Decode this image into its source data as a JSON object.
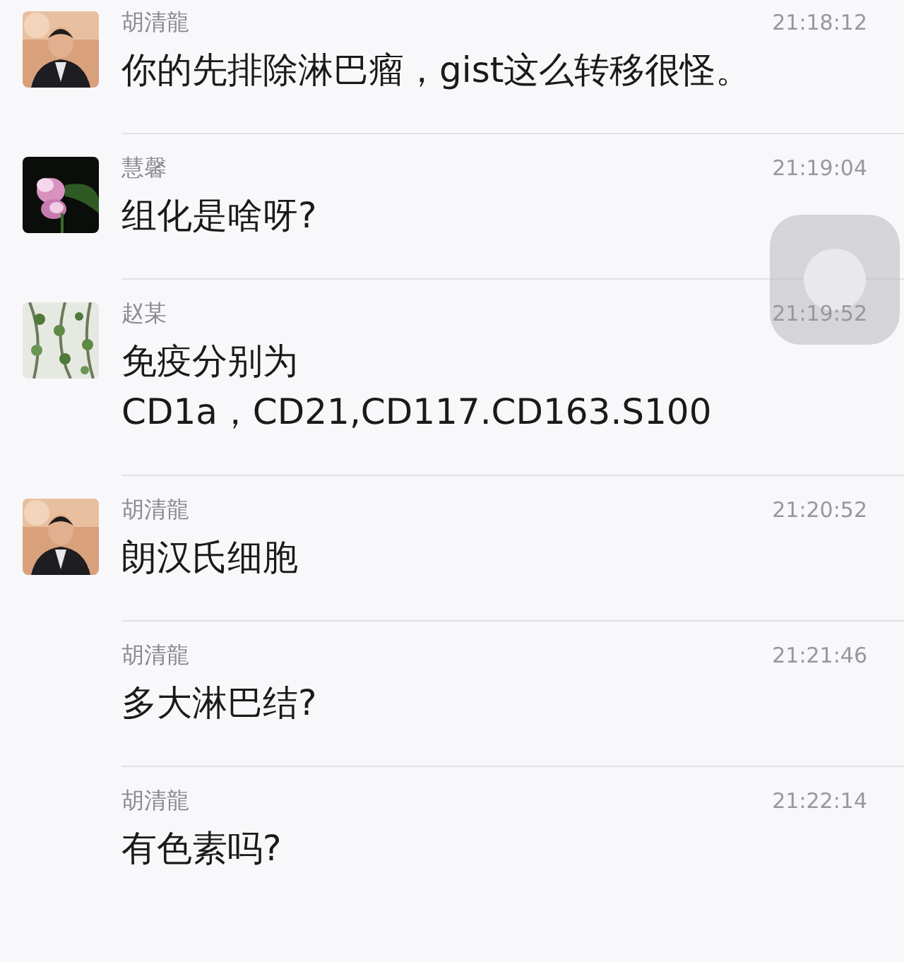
{
  "messages": [
    {
      "sender": "胡清龍",
      "time": "21:18:12",
      "text": "你的先排除淋巴瘤，gist这么转移很怪。"
    },
    {
      "sender": "慧馨",
      "time": "21:19:04",
      "text": "组化是啥呀?"
    },
    {
      "sender": "赵某",
      "time": "21:19:52",
      "text": "免疫分别为\nCD1a，CD21,CD117.CD163.S100"
    },
    {
      "sender": "胡清龍",
      "time": "21:20:52",
      "text": "朗汉氏细胞"
    },
    {
      "sender": "胡清龍",
      "time": "21:21:46",
      "text": "多大淋巴结?"
    },
    {
      "sender": "胡清龍",
      "time": "21:22:14",
      "text": "有色素吗?"
    }
  ],
  "assistive_touch": {
    "kind": "floating-button"
  }
}
